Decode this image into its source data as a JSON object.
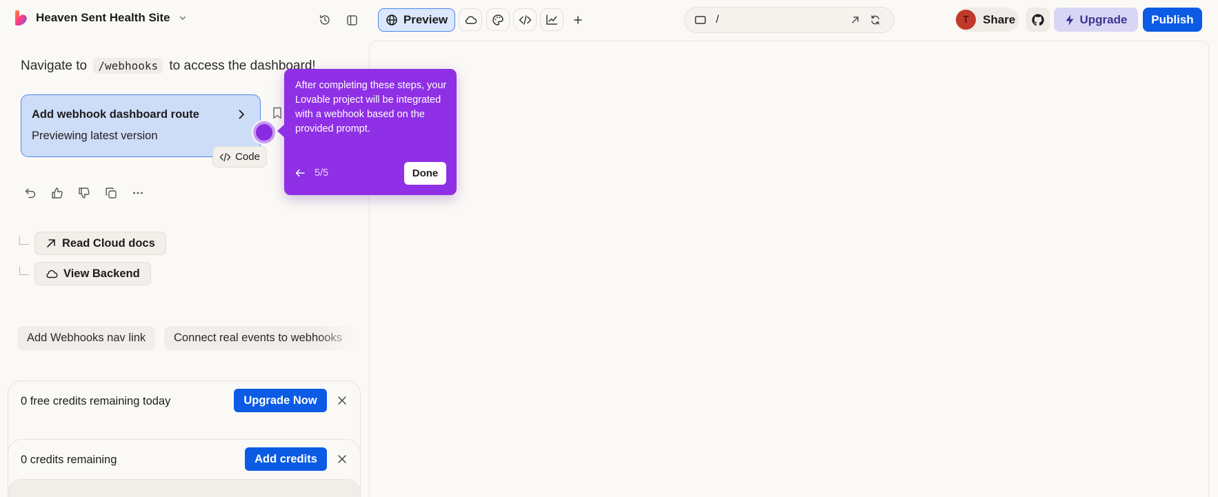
{
  "header": {
    "project_name": "Heaven Sent Health Site",
    "preview_label": "Preview",
    "url_path": "/",
    "avatar_initial": "T",
    "share_label": "Share",
    "upgrade_label": "Upgrade",
    "publish_label": "Publish"
  },
  "chat": {
    "nav_prefix": "Navigate to",
    "nav_code": "/webhooks",
    "nav_suffix": "to access the dashboard!",
    "version_card": {
      "title": "Add webhook dashboard route",
      "subtitle": "Previewing latest version"
    },
    "code_label": "Code",
    "links": [
      {
        "label": "Read Cloud docs",
        "icon": "arrow-up-right-icon"
      },
      {
        "label": "View Backend",
        "icon": "cloud-icon"
      }
    ],
    "suggestions": [
      "Add Webhooks nav link",
      "Connect real events to webhooks"
    ]
  },
  "credits": {
    "free_text": "0 free credits remaining today",
    "free_button": "Upgrade Now",
    "remaining_text": "0 credits remaining",
    "remaining_button": "Add credits"
  },
  "tooltip": {
    "text": "After completing these steps, your Lovable project will be integrated with a webhook based on the provided prompt.",
    "step": "5/5",
    "done_label": "Done"
  },
  "colors": {
    "accent_blue": "#0b5be5",
    "tooltip_purple": "#8f2fe6",
    "selection_blue": "#cddcf7",
    "upgrade_purple": "#d9d6f5"
  }
}
